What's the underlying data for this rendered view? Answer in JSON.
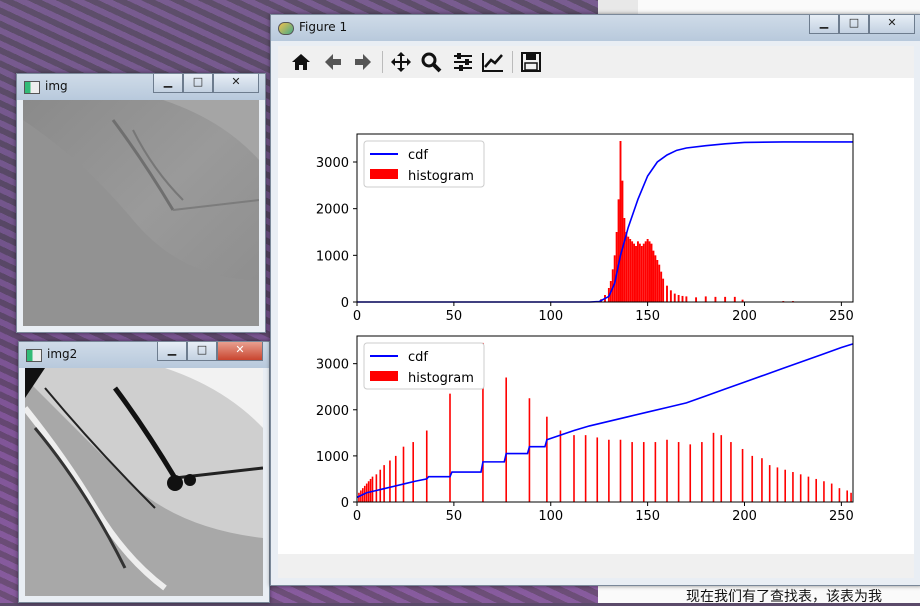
{
  "background_doc": {
    "bottom_text": "现在我们有了查找表，该表为我"
  },
  "img_window": {
    "title": "img",
    "buttons": [
      "minimize",
      "maximize",
      "close"
    ]
  },
  "img2_window": {
    "title": "img2",
    "buttons": [
      "minimize",
      "maximize",
      "close"
    ]
  },
  "figure_window": {
    "title": "Figure 1",
    "toolbar": [
      {
        "name": "home-icon"
      },
      {
        "name": "back-icon"
      },
      {
        "name": "forward-icon"
      },
      {
        "name": "pan-icon"
      },
      {
        "name": "zoom-icon"
      },
      {
        "name": "configure-subplots-icon"
      },
      {
        "name": "edit-axis-icon"
      },
      {
        "name": "save-icon"
      }
    ]
  },
  "chart_data": [
    {
      "type": "bar",
      "legend": [
        "cdf",
        "histogram"
      ],
      "legend_position": "top-left",
      "xlim": [
        0,
        256
      ],
      "ylim": [
        0,
        3600
      ],
      "xticks": [
        "0",
        "50",
        "100",
        "150",
        "200",
        "250"
      ],
      "yticks": [
        "0",
        "1000",
        "2000",
        "3000"
      ],
      "colors": {
        "cdf": "#0000ff",
        "histogram": "#ff0000"
      },
      "histogram": {
        "x": [
          124,
          126,
          128,
          130,
          131,
          132,
          133,
          134,
          135,
          136,
          137,
          138,
          139,
          140,
          141,
          142,
          143,
          144,
          145,
          146,
          147,
          148,
          149,
          150,
          151,
          152,
          153,
          154,
          155,
          156,
          157,
          158,
          160,
          162,
          164,
          166,
          168,
          170,
          175,
          180,
          185,
          190,
          195,
          199,
          220,
          225
        ],
        "values": [
          20,
          60,
          150,
          300,
          450,
          700,
          1000,
          1500,
          2200,
          3450,
          2600,
          1800,
          1500,
          1400,
          1350,
          1300,
          1250,
          1200,
          1300,
          1250,
          1200,
          1250,
          1300,
          1350,
          1300,
          1250,
          1100,
          1000,
          900,
          800,
          650,
          500,
          350,
          250,
          180,
          150,
          130,
          120,
          100,
          120,
          110,
          110,
          110,
          50,
          20,
          20
        ]
      },
      "cdf": {
        "x": [
          0,
          120,
          125,
          130,
          133,
          136,
          140,
          145,
          150,
          155,
          160,
          165,
          170,
          180,
          190,
          200,
          220,
          256
        ],
        "values": [
          0,
          0,
          10,
          120,
          400,
          1000,
          1600,
          2200,
          2700,
          3000,
          3150,
          3250,
          3300,
          3350,
          3390,
          3420,
          3430,
          3430
        ]
      }
    },
    {
      "type": "bar",
      "legend": [
        "cdf",
        "histogram"
      ],
      "legend_position": "top-left",
      "xlim": [
        0,
        256
      ],
      "ylim": [
        0,
        3600
      ],
      "xticks": [
        "0",
        "50",
        "100",
        "150",
        "200",
        "250"
      ],
      "yticks": [
        "0",
        "1000",
        "2000",
        "3000"
      ],
      "colors": {
        "cdf": "#0000ff",
        "histogram": "#ff0000"
      },
      "histogram": {
        "x": [
          1,
          2,
          3,
          4,
          5,
          6,
          7,
          8,
          10,
          12,
          14,
          17,
          20,
          24,
          29,
          36,
          48,
          65,
          77,
          89,
          98,
          105,
          112,
          118,
          124,
          130,
          136,
          142,
          148,
          154,
          160,
          166,
          172,
          178,
          184,
          188,
          193,
          199,
          204,
          209,
          213,
          217,
          221,
          225,
          229,
          233,
          237,
          241,
          245,
          249,
          253,
          255
        ],
        "values": [
          200,
          250,
          300,
          350,
          400,
          450,
          500,
          550,
          600,
          700,
          800,
          900,
          1000,
          1200,
          1300,
          1550,
          2350,
          3450,
          2700,
          2250,
          1850,
          1550,
          1450,
          1450,
          1400,
          1350,
          1350,
          1300,
          1300,
          1300,
          1350,
          1300,
          1250,
          1300,
          1500,
          1450,
          1300,
          1150,
          1000,
          950,
          800,
          750,
          700,
          650,
          600,
          550,
          500,
          450,
          400,
          300,
          250,
          200
        ]
      },
      "cdf": {
        "x": [
          0,
          5,
          10,
          15,
          20,
          25,
          30,
          36,
          37,
          48,
          49,
          64,
          65,
          76,
          77,
          88,
          89,
          97,
          98,
          105,
          112,
          120,
          130,
          140,
          150,
          160,
          170,
          180,
          190,
          200,
          210,
          220,
          230,
          240,
          250,
          256
        ],
        "values": [
          100,
          200,
          250,
          300,
          350,
          400,
          450,
          500,
          550,
          550,
          650,
          650,
          870,
          870,
          1050,
          1050,
          1200,
          1200,
          1350,
          1450,
          1550,
          1650,
          1750,
          1850,
          1950,
          2050,
          2150,
          2300,
          2450,
          2600,
          2750,
          2900,
          3050,
          3200,
          3350,
          3430
        ]
      }
    }
  ]
}
